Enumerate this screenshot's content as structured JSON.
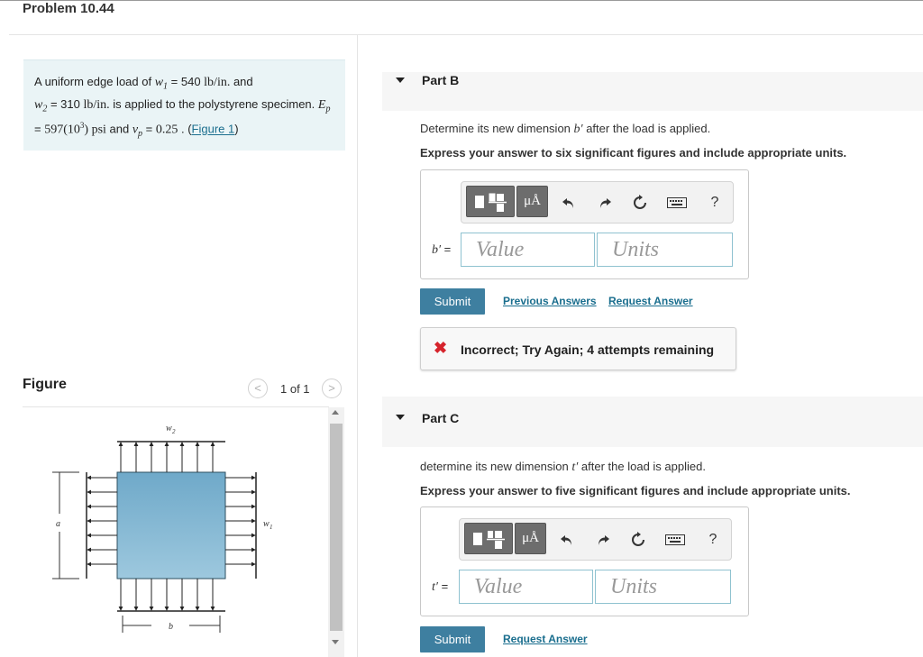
{
  "problem": {
    "title": "Problem 10.44",
    "statement": {
      "t1": "A uniform edge load of ",
      "w1": "w",
      "w1_sub": "1",
      "eq1": " = 540 ",
      "unit1": "lb/in.",
      "t2": " and",
      "w2": "w",
      "w2_sub": "2",
      "eq2": " = 310 ",
      "unit2": "lb/in.",
      "t3": " is applied to the polystyrene specimen. ",
      "E": "E",
      "E_sub": "p",
      "eq3": " = ",
      "E_val": "597(10",
      "E_exp": "3",
      "E_close": ")",
      "psi": " psi",
      "t4": " and ",
      "nu": "ν",
      "nu_sub": "p",
      "eq4": " = ",
      "nu_val": "0.25",
      "t5": " . (",
      "fig_link": "Figure 1",
      "t6": ")"
    }
  },
  "figure": {
    "label": "Figure",
    "pager": "1 of 1",
    "prev_glyph": "<",
    "next_glyph": ">",
    "labels": {
      "w2": "w",
      "w2_sub": "2",
      "w1": "w",
      "w1_sub": "1",
      "a": "a",
      "b": "b"
    }
  },
  "toolbar_icons": [
    "template-icon",
    "micro-angstrom-icon",
    "undo-icon",
    "redo-icon",
    "reset-icon",
    "keyboard-icon",
    "help-icon"
  ],
  "toolbar": {
    "mu_label": "μÅ",
    "help": "?"
  },
  "part_b": {
    "title": "Part B",
    "prompt_pre": "Determine its new dimension ",
    "var": "b′",
    "prompt_post": " after the load is applied.",
    "instruction": "Express your answer to six significant figures and include appropriate units.",
    "var_label": "b′",
    "eq": " =",
    "value_placeholder": "Value",
    "units_placeholder": "Units",
    "submit": "Submit",
    "previous_answers": "Previous Answers",
    "request_answer": "Request Answer",
    "feedback": "Incorrect; Try Again; 4 attempts remaining",
    "feedback_icon": "✖"
  },
  "part_c": {
    "title": "Part C",
    "prompt_pre": "determine its new dimension ",
    "var": "t′",
    "prompt_post": " after the load is applied.",
    "instruction": "Express your answer to five significant figures and include appropriate units.",
    "var_label": "t′",
    "eq": " =",
    "value_placeholder": "Value",
    "units_placeholder": "Units",
    "submit": "Submit",
    "request_answer": "Request Answer"
  },
  "colors": {
    "accent": "#3e7fa0",
    "link": "#1a6e8e",
    "error": "#d6242c",
    "problem_bg": "#eaf4f6",
    "specimen": "#7fb3cf"
  }
}
